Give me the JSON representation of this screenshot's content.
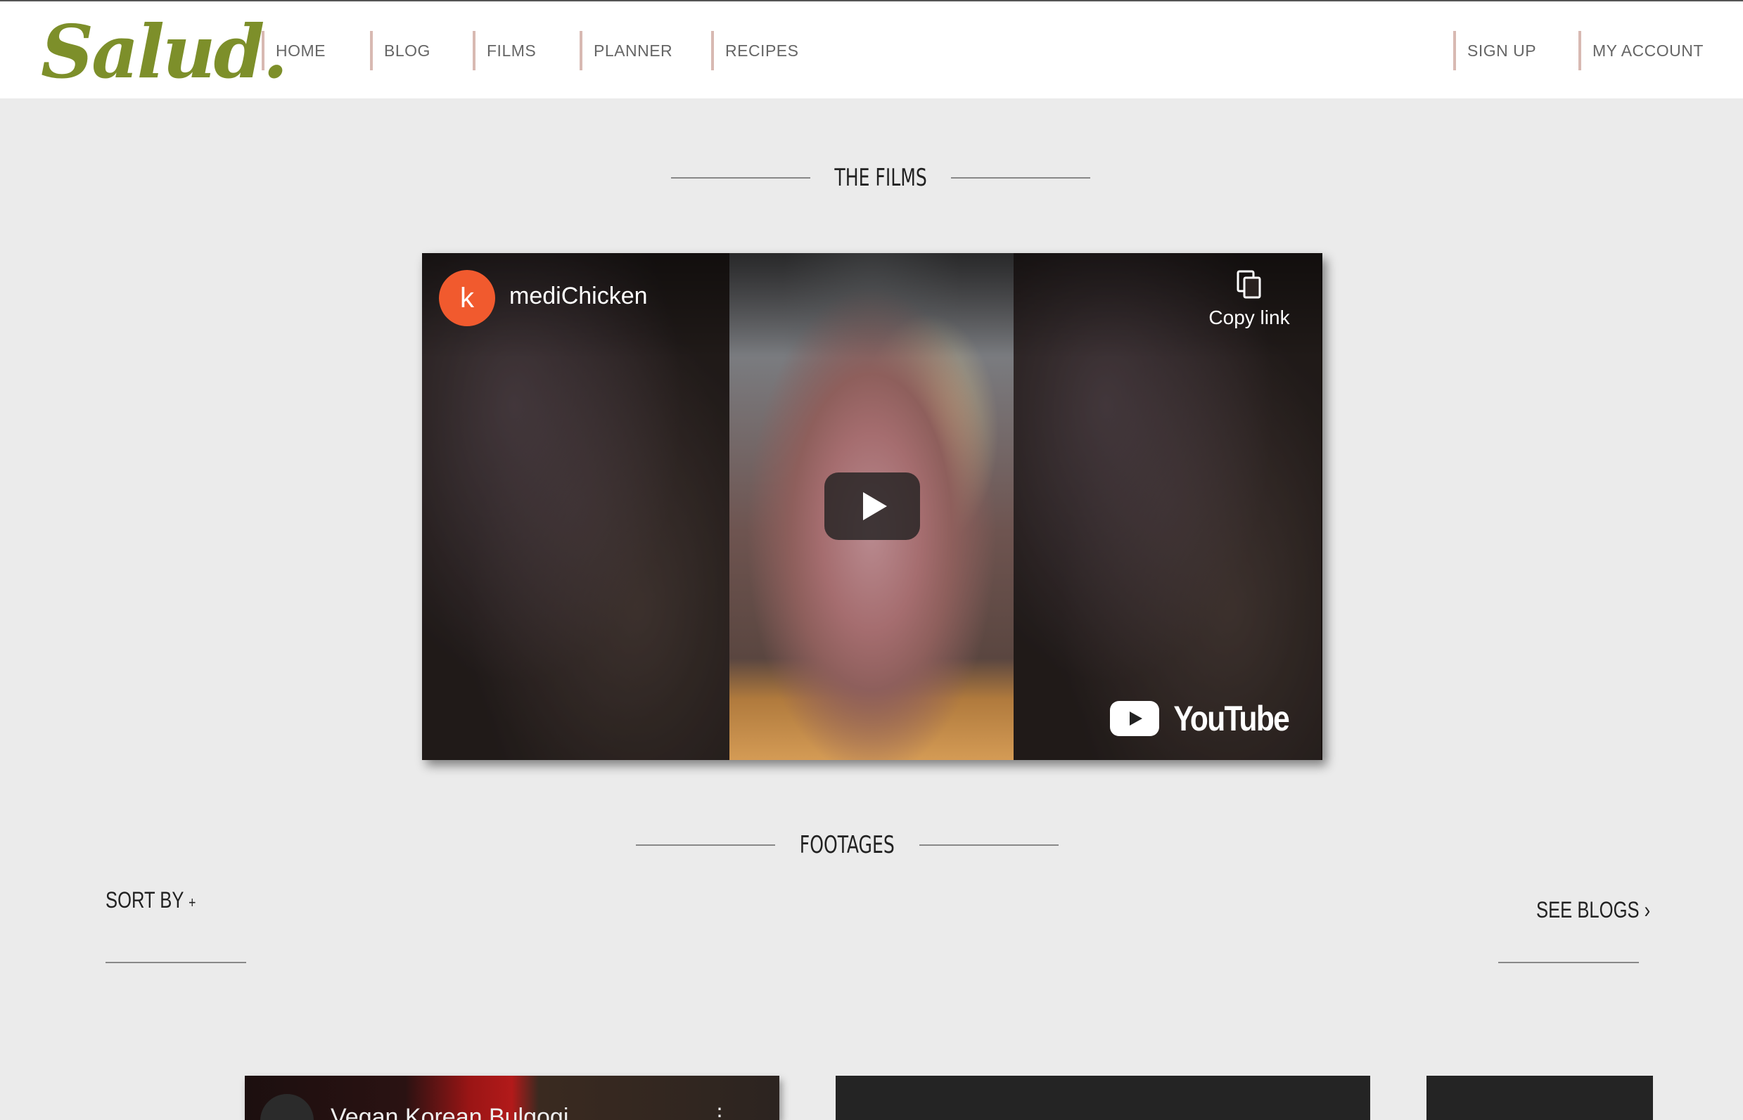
{
  "site": {
    "logo": "Salud."
  },
  "nav": {
    "left": [
      {
        "label": "HOME"
      },
      {
        "label": "BLOG"
      },
      {
        "label": "FILMS"
      },
      {
        "label": "PLANNER"
      },
      {
        "label": "RECIPES"
      }
    ],
    "right": [
      {
        "label": "SIGN UP"
      },
      {
        "label": "MY ACCOUNT"
      }
    ]
  },
  "films": {
    "heading": "THE FILMS",
    "video": {
      "channel_initial": "k",
      "channel_name": "mediChicken",
      "copy_link_label": "Copy link",
      "brand": "YouTube"
    }
  },
  "footages": {
    "heading": "FOOTAGES",
    "sort_label": "SORT BY",
    "sort_icon": "+",
    "see_blogs_label": "SEE BLOGS",
    "see_blogs_icon": "›",
    "cards": [
      {
        "title": "Vegan Korean Bulgogi",
        "menu_icon": "⋮"
      },
      {
        "title": ""
      },
      {
        "title": ""
      }
    ]
  },
  "colors": {
    "logo": "#7d8f2a",
    "nav_divider": "#d8b9b2",
    "background": "#ebebeb",
    "channel_avatar": "#f15a2e"
  }
}
